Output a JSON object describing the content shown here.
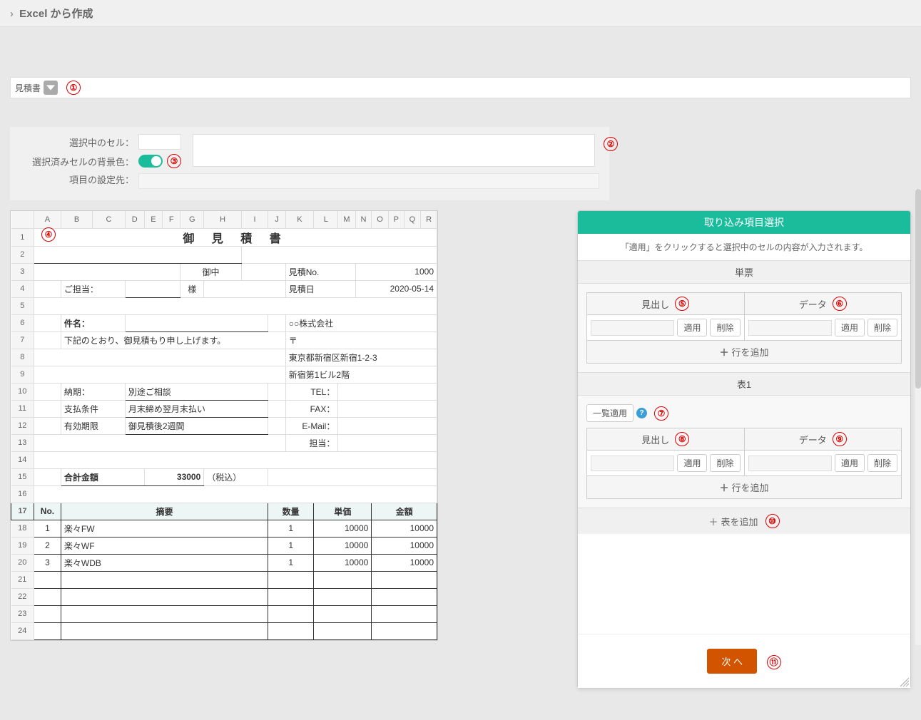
{
  "header": {
    "title": "Excel から作成"
  },
  "dropdown": {
    "label": "見積書"
  },
  "markers": {
    "m1": "①",
    "m2": "②",
    "m3": "③",
    "m4": "④",
    "m5": "⑤",
    "m6": "⑥",
    "m7": "⑦",
    "m8": "⑧",
    "m9": "⑨",
    "m10": "⑩",
    "m11": "⑪"
  },
  "info": {
    "selected_cell_label": "選択中のセル：",
    "bg_color_label": "選択済みセルの背景色：",
    "dest_label": "項目の設定先："
  },
  "sheet": {
    "cols": [
      "A",
      "B",
      "C",
      "D",
      "E",
      "F",
      "G",
      "H",
      "I",
      "J",
      "K",
      "L",
      "M",
      "N",
      "O",
      "P",
      "Q",
      "R"
    ],
    "title": "御 見 積 書",
    "onchu": "御中",
    "est_no_label": "見積No.",
    "est_no_val": "1000",
    "est_date_label": "見積日",
    "est_date_val": "2020-05-14",
    "contact_label": "ご担当：",
    "contact_suffix": "様",
    "subject_label": "件名：",
    "company": "○○株式会社",
    "note": "下記のとおり、御見積もり申し上げます。",
    "postal": "〒",
    "addr1": "東京都新宿区新宿1-2-3",
    "addr2": "新宿第1ビル2階",
    "delivery_label": "納期：",
    "delivery_val": "別途ご相談",
    "tel_label": "TEL：",
    "pay_label": "支払条件",
    "pay_val": "月末締め翌月末払い",
    "fax_label": "FAX：",
    "valid_label": "有効期限",
    "valid_val": "御見積後2週間",
    "email_label": "E-Mail：",
    "staff_label": "担当：",
    "total_label": "合計金額",
    "total_val": "33000",
    "tax_note": "（税込）",
    "headers": {
      "no": "No.",
      "summary": "摘要",
      "qty": "数量",
      "unit": "単価",
      "amount": "金額"
    },
    "rows": [
      {
        "no": "1",
        "summary": "楽々FW",
        "qty": "1",
        "unit": "10000",
        "amount": "10000"
      },
      {
        "no": "2",
        "summary": "楽々WF",
        "qty": "1",
        "unit": "10000",
        "amount": "10000"
      },
      {
        "no": "3",
        "summary": "楽々WDB",
        "qty": "1",
        "unit": "10000",
        "amount": "10000"
      }
    ]
  },
  "panel": {
    "title": "取り込み項目選択",
    "subtitle": "「適用」をクリックすると選択中のセルの内容が入力されます。",
    "section1": "単票",
    "section2": "表1",
    "heading_label": "見出し",
    "data_label": "データ",
    "apply": "適用",
    "delete": "削除",
    "add_row": "行を追加",
    "bulk_apply": "一覧適用",
    "add_table": "表を追加",
    "next": "次 へ"
  }
}
